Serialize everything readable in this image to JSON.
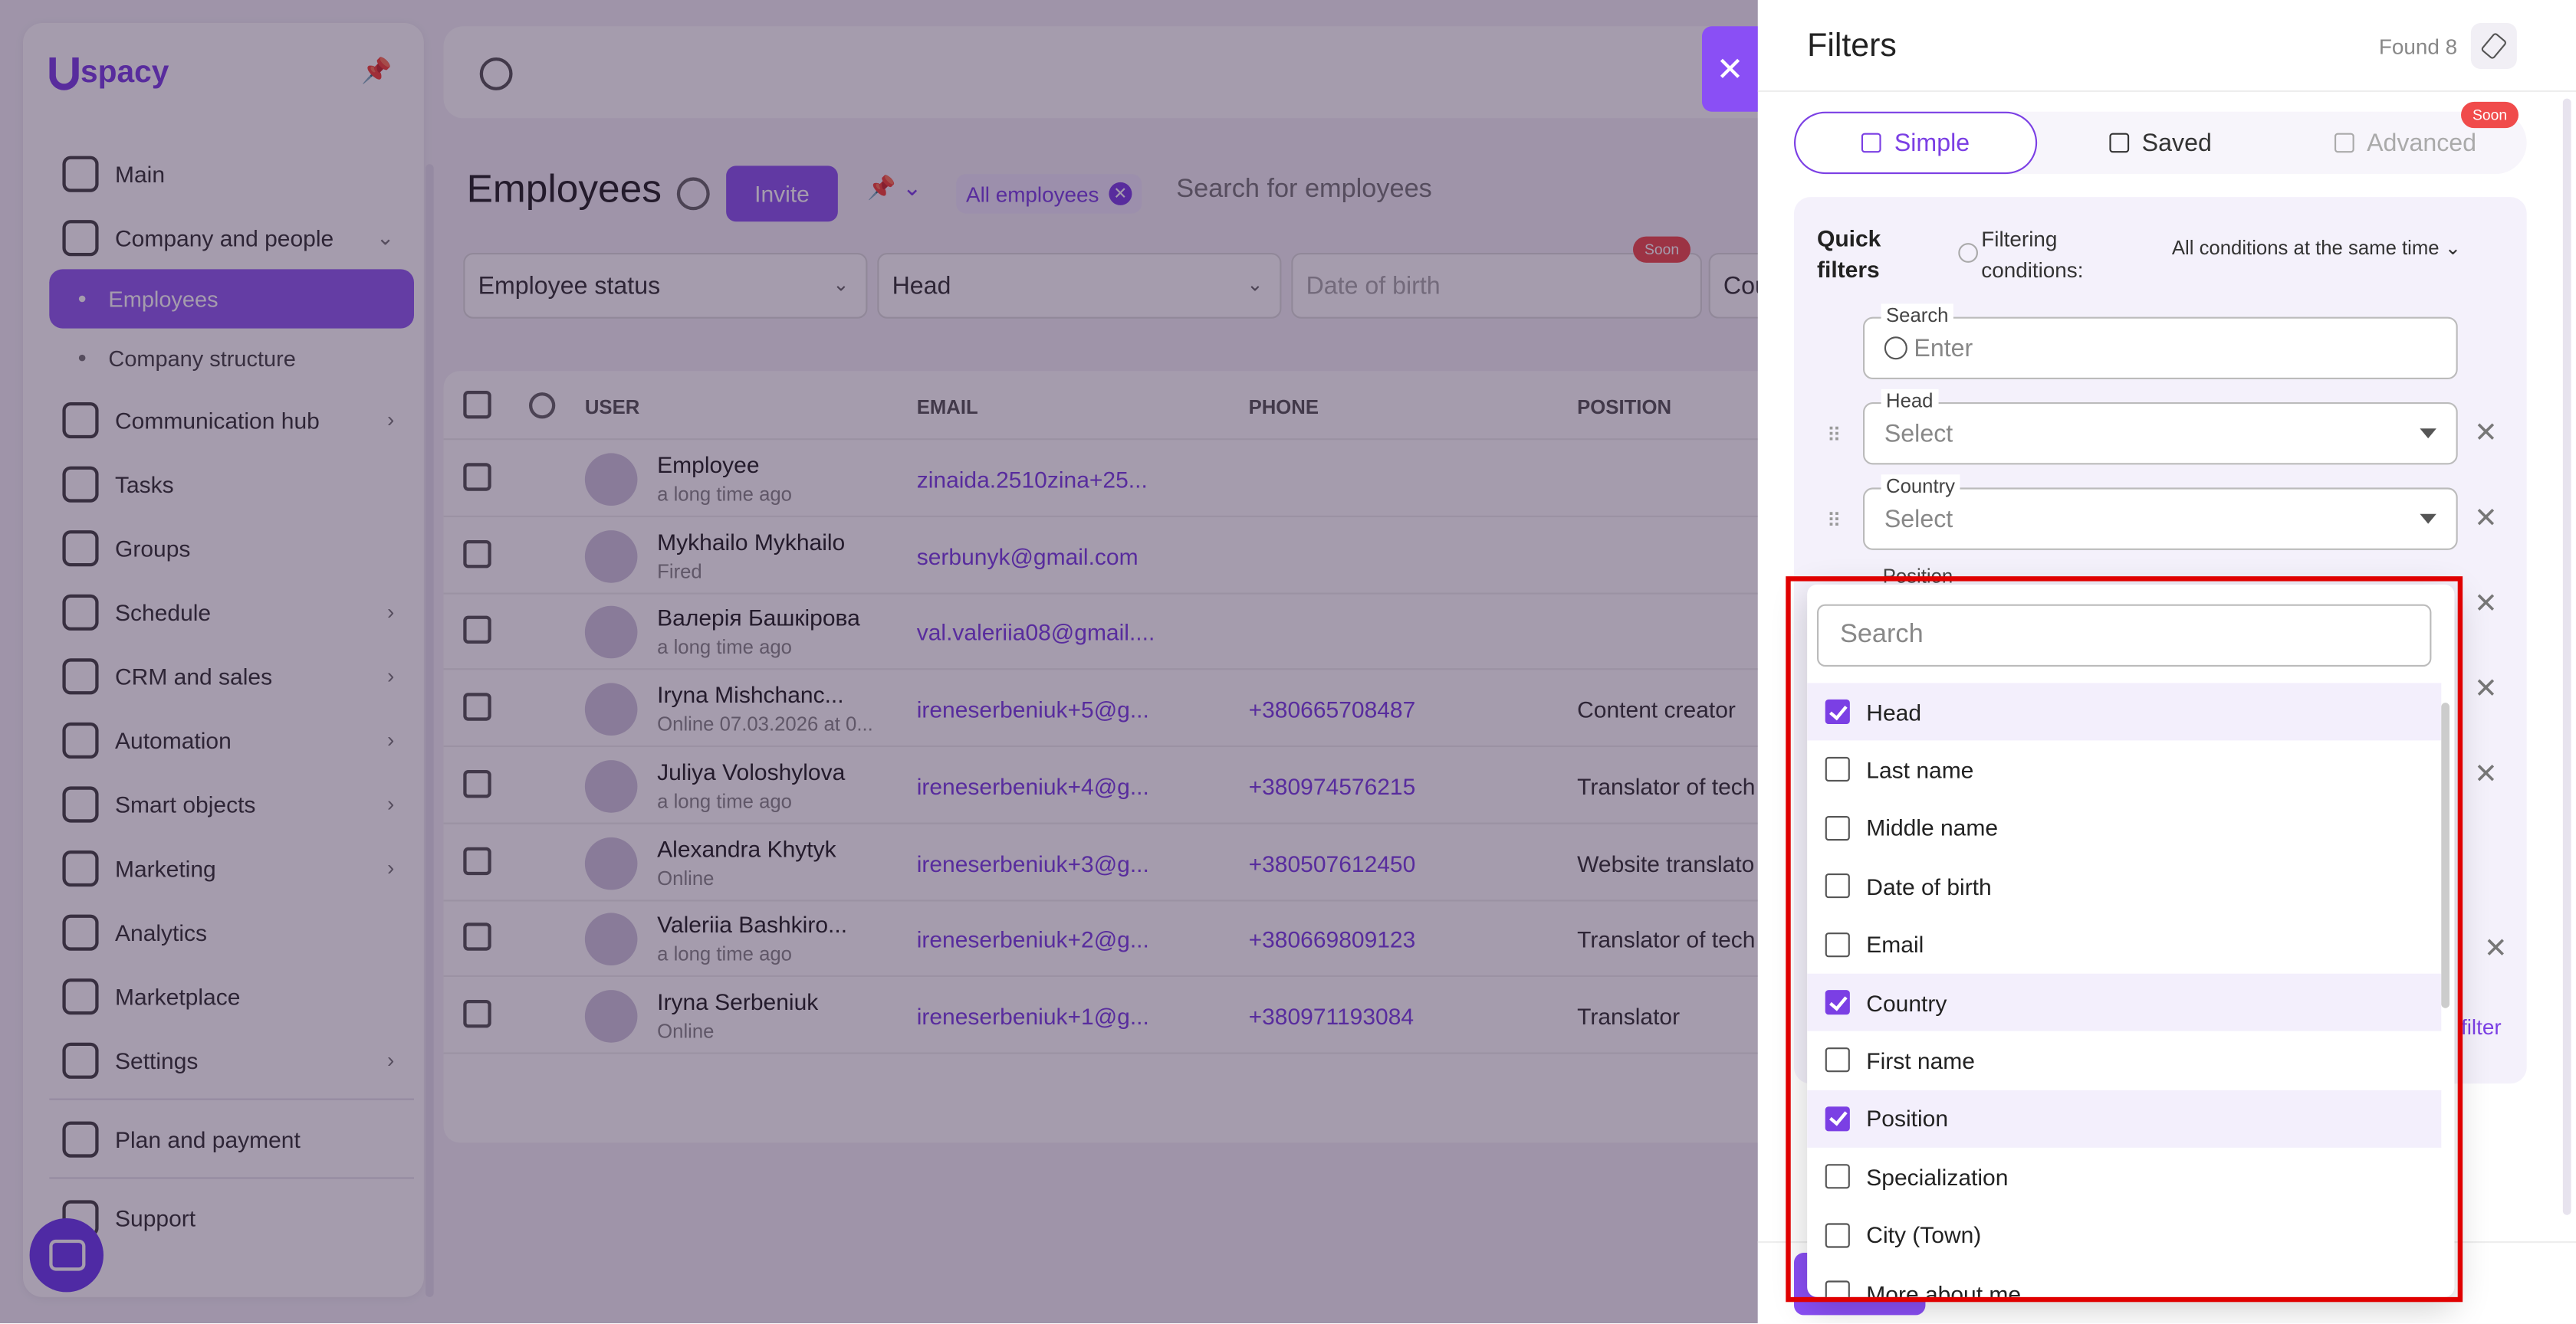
{
  "app": {
    "logo": "spacy"
  },
  "sidebar": {
    "items": [
      {
        "label": "Main",
        "icon": "home-icon"
      },
      {
        "label": "Company and people",
        "icon": "building-icon",
        "chevron": "down"
      },
      {
        "label": "Employees",
        "sub": true,
        "active": true
      },
      {
        "label": "Company structure",
        "sub": true
      },
      {
        "label": "Communication hub",
        "icon": "chat-icon",
        "chevron": "right"
      },
      {
        "label": "Tasks",
        "icon": "check-circle-icon"
      },
      {
        "label": "Groups",
        "icon": "users-icon"
      },
      {
        "label": "Schedule",
        "icon": "calendar-icon",
        "chevron": "right"
      },
      {
        "label": "CRM and sales",
        "icon": "database-icon",
        "chevron": "right"
      },
      {
        "label": "Automation",
        "icon": "bolt-icon",
        "chevron": "right"
      },
      {
        "label": "Smart objects",
        "icon": "smart-object-icon",
        "chevron": "right"
      },
      {
        "label": "Marketing",
        "icon": "marketing-icon",
        "chevron": "right"
      },
      {
        "label": "Analytics",
        "icon": "analytics-icon"
      },
      {
        "label": "Marketplace",
        "icon": "marketplace-icon"
      },
      {
        "label": "Settings",
        "icon": "gear-icon",
        "chevron": "right"
      },
      {
        "label": "Plan and payment",
        "icon": "wallet-icon"
      },
      {
        "label": "Support",
        "icon": "support-icon"
      }
    ]
  },
  "page": {
    "title": "Employees",
    "invite": "Invite",
    "chip": "All employees",
    "search_placeholder": "Search for employees",
    "filters": {
      "status": "Employee status",
      "head": "Head",
      "dob": "Date of birth",
      "country_partial": "Cou",
      "soon": "Soon"
    }
  },
  "table": {
    "headers": {
      "user": "USER",
      "email": "EMAIL",
      "phone": "PHONE",
      "position": "POSITION"
    },
    "rows": [
      {
        "name": "Employee",
        "status": "a long time ago",
        "email": "zinaida.2510zina+25...",
        "phone": "",
        "position": ""
      },
      {
        "name": "Mykhailo Mykhailo",
        "status": "Fired",
        "email": "serbunyk@gmail.com",
        "phone": "",
        "position": ""
      },
      {
        "name": "Валерія Башкірова",
        "status": "a long time ago",
        "email": "val.valeriia08@gmail....",
        "phone": "",
        "position": ""
      },
      {
        "name": "Iryna Mishchanc...",
        "status": "Online 07.03.2026 at 0...",
        "email": "ireneserbeniuk+5@g...",
        "phone": "+380665708487",
        "position": "Content creator"
      },
      {
        "name": "Juliya Voloshylova",
        "status": "a long time ago",
        "email": "ireneserbeniuk+4@g...",
        "phone": "+380974576215",
        "position": "Translator of tech"
      },
      {
        "name": "Alexandra Khytyk",
        "status": "Online",
        "email": "ireneserbeniuk+3@g...",
        "phone": "+380507612450",
        "position": "Website translato"
      },
      {
        "name": "Valeriia Bashkiro...",
        "status": "a long time ago",
        "email": "ireneserbeniuk+2@g...",
        "phone": "+380669809123",
        "position": "Translator of tech"
      },
      {
        "name": "Iryna Serbeniuk",
        "status": "Online",
        "email": "ireneserbeniuk+1@g...",
        "phone": "+380971193084",
        "position": "Translator"
      }
    ]
  },
  "panel": {
    "title": "Filters",
    "found": "Found 8",
    "tabs": {
      "simple": "Simple",
      "saved": "Saved",
      "advanced": "Advanced",
      "soon": "Soon"
    },
    "quick_filters": "Quick filters",
    "filtering_conditions": "Filtering conditions:",
    "conditions_value": "All conditions at the same time",
    "search_label": "Search",
    "search_placeholder": "Enter",
    "head_label": "Head",
    "country_label": "Country",
    "position_label": "Position",
    "select_placeholder": "Select",
    "add_filter_partial": "filter"
  },
  "dropdown": {
    "search_placeholder": "Search",
    "options": [
      {
        "label": "Head",
        "checked": true
      },
      {
        "label": "Last name",
        "checked": false
      },
      {
        "label": "Middle name",
        "checked": false
      },
      {
        "label": "Date of birth",
        "checked": false
      },
      {
        "label": "Email",
        "checked": false
      },
      {
        "label": "Country",
        "checked": true
      },
      {
        "label": "First name",
        "checked": false
      },
      {
        "label": "Position",
        "checked": true
      },
      {
        "label": "Specialization",
        "checked": false
      },
      {
        "label": "City (Town)",
        "checked": false
      },
      {
        "label": "More about me",
        "checked": false
      }
    ]
  },
  "colors": {
    "accent": "#7b3fe4",
    "highlight": "#e00000",
    "soon": "#f04b4b"
  }
}
